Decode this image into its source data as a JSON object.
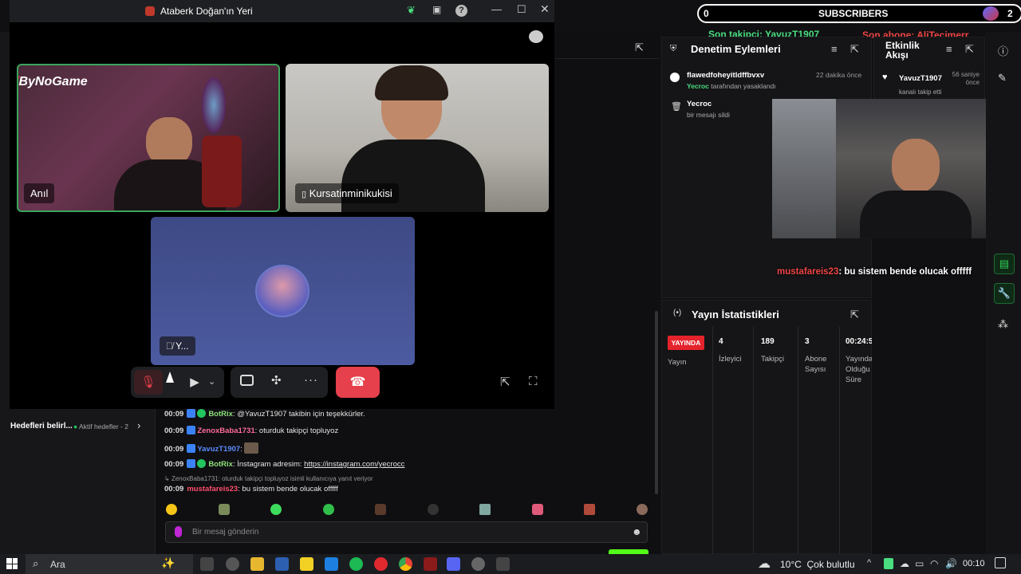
{
  "call": {
    "window_title": "Ataberk Doğan'ın Yeri",
    "tiles": [
      {
        "name": "Anıl",
        "logo": "ByNoGame"
      },
      {
        "name": "Kursatinminikukisi"
      },
      {
        "name": "Y..."
      }
    ]
  },
  "subscribers": {
    "count": "0",
    "label": "SUBSCRIBERS",
    "right_count": "2"
  },
  "overlay": {
    "last_follower": "Son takipçi: YavuzT1907",
    "last_sub": "Son abone: AliTecimerr",
    "chat_overlay_user": "mustafareis23",
    "chat_overlay_msg": ": bu sistem bende olucak offfff"
  },
  "moderation": {
    "title": "Denetim Eylemleri",
    "items": [
      {
        "user": "flawedfoheyitldffbvxv",
        "actor": "Yecroc",
        "action": " tarafından yasaklandı",
        "time": "22 dakika önce"
      },
      {
        "user": "Yecroc",
        "action": "bir mesajı sildi"
      }
    ]
  },
  "activity": {
    "title": "Etkinlik Akışı",
    "items": [
      {
        "user": "YavuzT1907",
        "action": "kanalı takip etti",
        "time": "56 saniye önce"
      }
    ]
  },
  "stats": {
    "title": "Yayın İstatistikleri",
    "live_badge": "YAYINDA",
    "live_label": "Yayın",
    "cols": [
      {
        "value": "4",
        "label": "İzleyici"
      },
      {
        "value": "189",
        "label": "Takipçi"
      },
      {
        "value": "3",
        "label": "Abone Sayısı"
      },
      {
        "value": "00:24:5",
        "label": "Yayında Olduğu Süre"
      }
    ]
  },
  "goals": {
    "label": "Hedefleri belirl...",
    "active": "Aktif hedefler - 2"
  },
  "chat": {
    "lines": [
      {
        "time": "00:09",
        "user": "BotRix",
        "color": "#8ee07a",
        "msg": ": @YavuzT1907 takibin için teşekkürler."
      },
      {
        "time": "00:09",
        "user": "ZenoxBaba1731",
        "color": "#ff6b9a",
        "msg": ": oturduk takipçi topluyoz"
      },
      {
        "time": "00:09",
        "user": "YavuzT1907",
        "color": "#5b8cff",
        "msg": ":"
      },
      {
        "time": "00:09",
        "user": "BotRix",
        "color": "#8ee07a",
        "msg": ": İnstagram adresim: ",
        "link": "https://instagram.com/yecrocc"
      },
      {
        "reply": "ZenoxBaba1731: oturduk takipçi topluyoz isimli kullanıcıya yanıt veriyor"
      },
      {
        "time": "00:09",
        "user": "mustafareis23",
        "color": "#ff4d6d",
        "msg": ": bu sistem bende olucak offfff"
      }
    ],
    "placeholder": "Bir mesaj gönderin"
  },
  "taskbar": {
    "search": "Ara",
    "weather": "10°C  Çok bulutlu",
    "time": "00:10"
  },
  "colors": {
    "accent_green": "#53fc18",
    "end_call": "#e5404b",
    "live_red": "#e5232c"
  }
}
